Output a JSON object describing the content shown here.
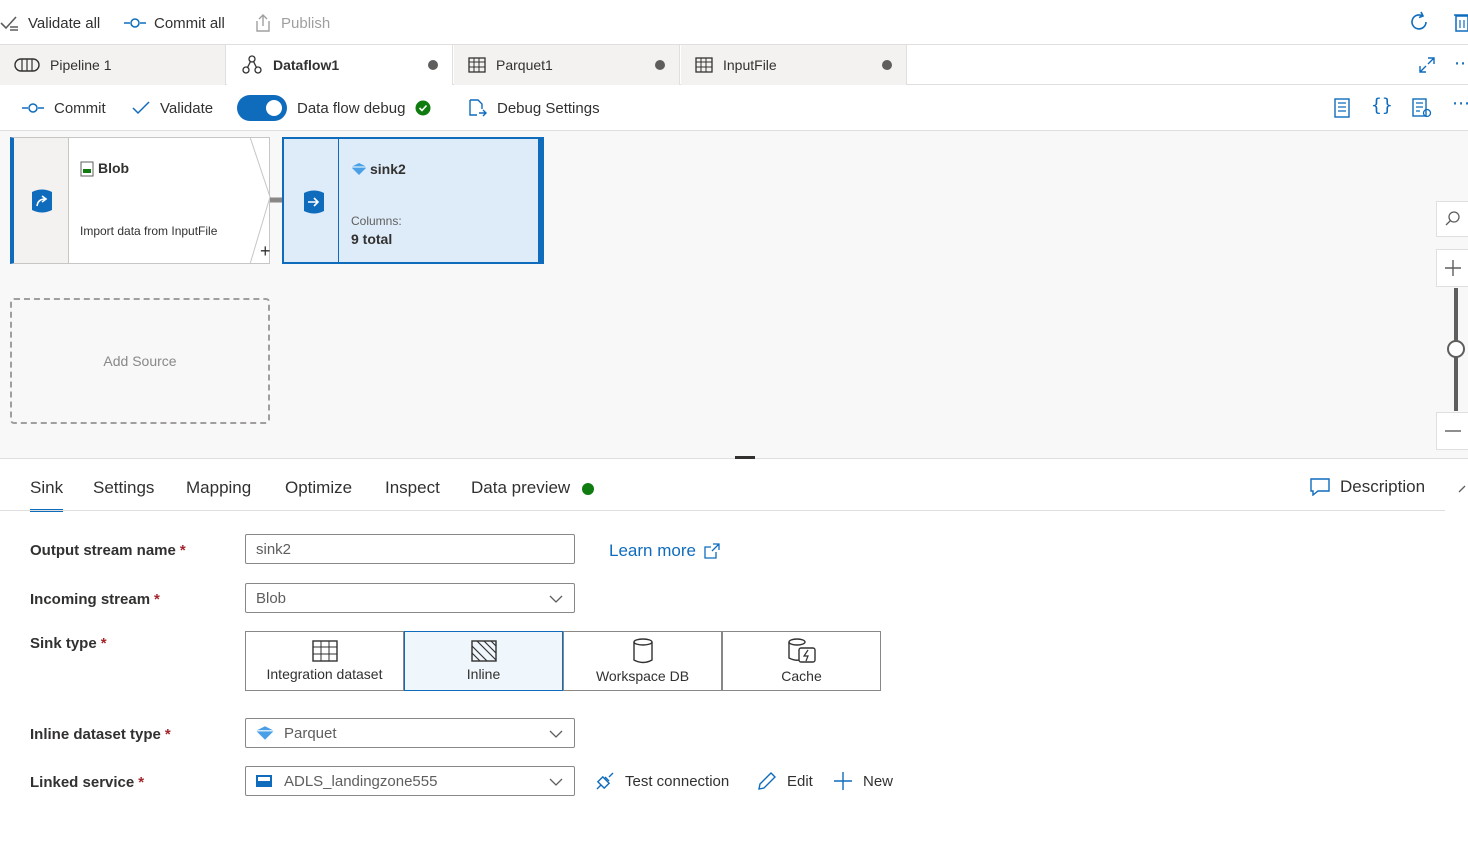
{
  "toolbar": {
    "validate_all": "Validate all",
    "commit_all": "Commit all",
    "publish": "Publish"
  },
  "tabs": [
    {
      "label": "Pipeline 1",
      "icon": "pipeline-icon"
    },
    {
      "label": "Dataflow1",
      "icon": "dataflow-icon",
      "active": true,
      "modified": true
    },
    {
      "label": "Parquet1",
      "icon": "table-icon",
      "modified": true
    },
    {
      "label": "InputFile",
      "icon": "table-icon",
      "modified": true
    }
  ],
  "commandbar": {
    "commit": "Commit",
    "validate": "Validate",
    "debug_label": "Data flow debug",
    "debug_on": true,
    "debug_settings": "Debug Settings"
  },
  "canvas": {
    "source_node": {
      "title": "Blob",
      "description": "Import data from InputFile"
    },
    "sink_node": {
      "title": "sink2",
      "columns_label": "Columns:",
      "columns_value": "9 total"
    },
    "add_source": "Add Source"
  },
  "panel": {
    "tabs": [
      "Sink",
      "Settings",
      "Mapping",
      "Optimize",
      "Inspect",
      "Data preview"
    ],
    "active_tab": "Sink",
    "description": "Description",
    "fields": {
      "output_stream_name": {
        "label": "Output stream name",
        "value": "sink2"
      },
      "learn_more": "Learn more",
      "incoming_stream": {
        "label": "Incoming stream",
        "value": "Blob"
      },
      "sink_type": {
        "label": "Sink type",
        "options": [
          "Integration dataset",
          "Inline",
          "Workspace DB",
          "Cache"
        ],
        "selected": "Inline"
      },
      "inline_dataset_type": {
        "label": "Inline dataset type",
        "value": "Parquet"
      },
      "linked_service": {
        "label": "Linked service",
        "value": "ADLS_landingzone555"
      }
    },
    "actions": {
      "test_connection": "Test connection",
      "edit": "Edit",
      "new": "New"
    },
    "required_mark": "*"
  },
  "colors": {
    "accent": "#0f6cbd",
    "success": "#107c10",
    "required": "#a4262c"
  }
}
